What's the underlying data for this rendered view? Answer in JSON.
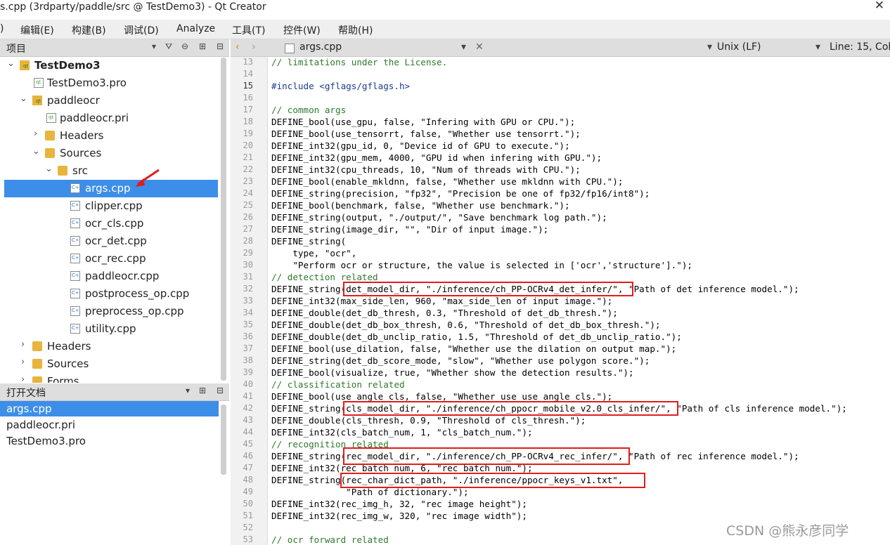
{
  "window": {
    "title": "s.cpp (3rdparty/paddle/src @ TestDemo3) - Qt Creator",
    "close_glyph": "✕"
  },
  "menu": [
    {
      "label": ")"
    },
    {
      "label": "编辑(E)"
    },
    {
      "label": "构建(B)"
    },
    {
      "label": "调试(D)"
    },
    {
      "label": "Analyze"
    },
    {
      "label": "工具(T)"
    },
    {
      "label": "控件(W)"
    },
    {
      "label": "帮助(H)"
    }
  ],
  "project_panel": {
    "title": "项目",
    "tree": [
      {
        "label": "TestDemo3",
        "bold": true
      },
      {
        "label": "TestDemo3.pro"
      },
      {
        "label": "paddleocr"
      },
      {
        "label": "paddleocr.pri"
      },
      {
        "label": "Headers"
      },
      {
        "label": "Sources"
      },
      {
        "label": "src"
      },
      {
        "label": "args.cpp"
      },
      {
        "label": "clipper.cpp"
      },
      {
        "label": "ocr_cls.cpp"
      },
      {
        "label": "ocr_det.cpp"
      },
      {
        "label": "ocr_rec.cpp"
      },
      {
        "label": "paddleocr.cpp"
      },
      {
        "label": "postprocess_op.cpp"
      },
      {
        "label": "preprocess_op.cpp"
      },
      {
        "label": "utility.cpp"
      },
      {
        "label": "Headers"
      },
      {
        "label": "Sources"
      },
      {
        "label": "Forms"
      }
    ]
  },
  "open_docs_panel": {
    "title": "打开文档",
    "docs": [
      {
        "label": "args.cpp"
      },
      {
        "label": "paddleocr.pri"
      },
      {
        "label": "TestDemo3.pro"
      }
    ]
  },
  "editor": {
    "file_name": "args.cpp",
    "line_ending": "Unix (LF)",
    "cursor_pos": "Line: 15, Col",
    "lines": [
      {
        "n": "13",
        "text": "// limitations under the License."
      },
      {
        "n": "14",
        "text": ""
      },
      {
        "n": "15",
        "text": "#include <gflags/gflags.h>"
      },
      {
        "n": "16",
        "text": ""
      },
      {
        "n": "17",
        "text": "// common args"
      },
      {
        "n": "18",
        "text": "DEFINE_bool(use_gpu, false, \"Infering with GPU or CPU.\");"
      },
      {
        "n": "19",
        "text": "DEFINE_bool(use_tensorrt, false, \"Whether use tensorrt.\");"
      },
      {
        "n": "20",
        "text": "DEFINE_int32(gpu_id, 0, \"Device id of GPU to execute.\");"
      },
      {
        "n": "21",
        "text": "DEFINE_int32(gpu_mem, 4000, \"GPU id when infering with GPU.\");"
      },
      {
        "n": "22",
        "text": "DEFINE_int32(cpu_threads, 10, \"Num of threads with CPU.\");"
      },
      {
        "n": "23",
        "text": "DEFINE_bool(enable_mkldnn, false, \"Whether use mkldnn with CPU.\");"
      },
      {
        "n": "24",
        "text": "DEFINE_string(precision, \"fp32\", \"Precision be one of fp32/fp16/int8\");"
      },
      {
        "n": "25",
        "text": "DEFINE_bool(benchmark, false, \"Whether use benchmark.\");"
      },
      {
        "n": "26",
        "text": "DEFINE_string(output, \"./output/\", \"Save benchmark log path.\");"
      },
      {
        "n": "27",
        "text": "DEFINE_string(image_dir, \"\", \"Dir of input image.\");"
      },
      {
        "n": "28",
        "text": "DEFINE_string("
      },
      {
        "n": "29",
        "text": "    type, \"ocr\","
      },
      {
        "n": "30",
        "text": "    \"Perform ocr or structure, the value is selected in ['ocr','structure'].\");"
      },
      {
        "n": "31",
        "text": "// detection related"
      },
      {
        "n": "32",
        "text": "DEFINE_string(det_model_dir, \"./inference/ch_PP-OCRv4_det_infer/\", \"Path of det inference model.\");"
      },
      {
        "n": "33",
        "text": "DEFINE_int32(max_side_len, 960, \"max_side_len of input image.\");"
      },
      {
        "n": "34",
        "text": "DEFINE_double(det_db_thresh, 0.3, \"Threshold of det_db_thresh.\");"
      },
      {
        "n": "35",
        "text": "DEFINE_double(det_db_box_thresh, 0.6, \"Threshold of det_db_box_thresh.\");"
      },
      {
        "n": "36",
        "text": "DEFINE_double(det_db_unclip_ratio, 1.5, \"Threshold of det_db_unclip_ratio.\");"
      },
      {
        "n": "37",
        "text": "DEFINE_bool(use_dilation, false, \"Whether use the dilation on output map.\");"
      },
      {
        "n": "38",
        "text": "DEFINE_string(det_db_score_mode, \"slow\", \"Whether use polygon score.\");"
      },
      {
        "n": "39",
        "text": "DEFINE_bool(visualize, true, \"Whether show the detection results.\");"
      },
      {
        "n": "40",
        "text": "// classification related"
      },
      {
        "n": "41",
        "text": "DEFINE_bool(use_angle_cls, false, \"Whether use use_angle_cls.\");"
      },
      {
        "n": "42",
        "text": "DEFINE_string(cls_model_dir, \"./inference/ch_ppocr_mobile_v2.0_cls_infer/\", \"Path of cls inference model.\");"
      },
      {
        "n": "43",
        "text": "DEFINE_double(cls_thresh, 0.9, \"Threshold of cls_thresh.\");"
      },
      {
        "n": "44",
        "text": "DEFINE_int32(cls_batch_num, 1, \"cls_batch_num.\");"
      },
      {
        "n": "45",
        "text": "// recognition related"
      },
      {
        "n": "46",
        "text": "DEFINE_string(rec_model_dir, \"./inference/ch_PP-OCRv4_rec_infer/\", \"Path of rec inference model.\");"
      },
      {
        "n": "47",
        "text": "DEFINE_int32(rec_batch_num, 6, \"rec_batch_num.\");"
      },
      {
        "n": "48",
        "text": "DEFINE_string(rec_char_dict_path, \"./inference/ppocr_keys_v1.txt\","
      },
      {
        "n": "49",
        "text": "              \"Path of dictionary.\");"
      },
      {
        "n": "50",
        "text": "DEFINE_int32(rec_img_h, 32, \"rec image height\");"
      },
      {
        "n": "51",
        "text": "DEFINE_int32(rec_img_w, 320, \"rec image width\");"
      },
      {
        "n": "52",
        "text": ""
      },
      {
        "n": "53",
        "text": "// ocr forward related"
      }
    ]
  },
  "watermark": "CSDN @熊永彦同学"
}
